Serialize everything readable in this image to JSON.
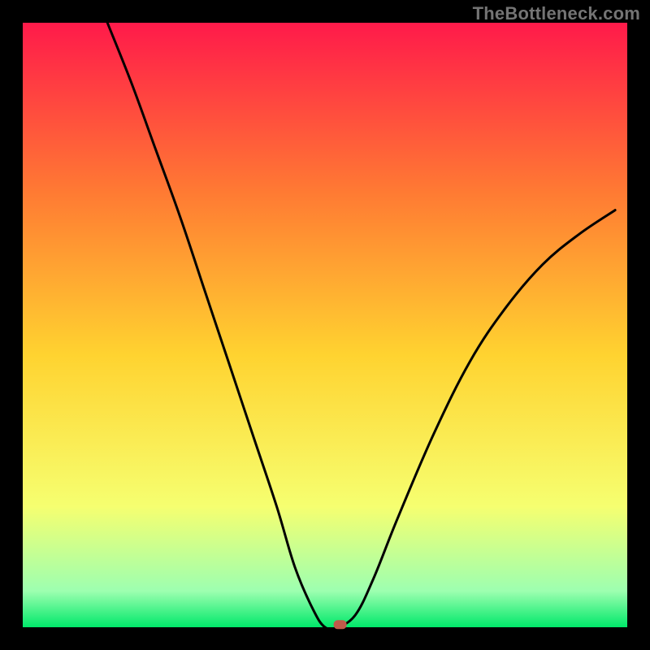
{
  "watermark": "TheBottleneck.com",
  "chart_data": {
    "type": "line",
    "title": "",
    "xlabel": "",
    "ylabel": "",
    "xlim": [
      0,
      100
    ],
    "ylim": [
      0,
      100
    ],
    "grid": false,
    "legend": false,
    "annotations": [],
    "background_gradient": {
      "top": "#ff1a4a",
      "upper_mid": "#ff7a33",
      "mid": "#ffd330",
      "lower": "#f6ff70",
      "near_bottom": "#9dffb0",
      "bottom": "#00e86a"
    },
    "series": [
      {
        "name": "curve",
        "x": [
          14,
          18,
          22,
          26,
          30,
          34,
          38,
          42,
          45,
          48,
          50,
          52,
          55,
          58,
          62,
          68,
          74,
          80,
          86,
          92,
          98
        ],
        "y": [
          100,
          90,
          79,
          68,
          56,
          44,
          32,
          20,
          10,
          3,
          0,
          0,
          2,
          8,
          18,
          32,
          44,
          53,
          60,
          65,
          69
        ]
      }
    ],
    "marker": {
      "x": 52.5,
      "y": 0.5,
      "color": "#bf5a4a"
    },
    "tick_labels": {
      "x": [],
      "y": []
    }
  }
}
